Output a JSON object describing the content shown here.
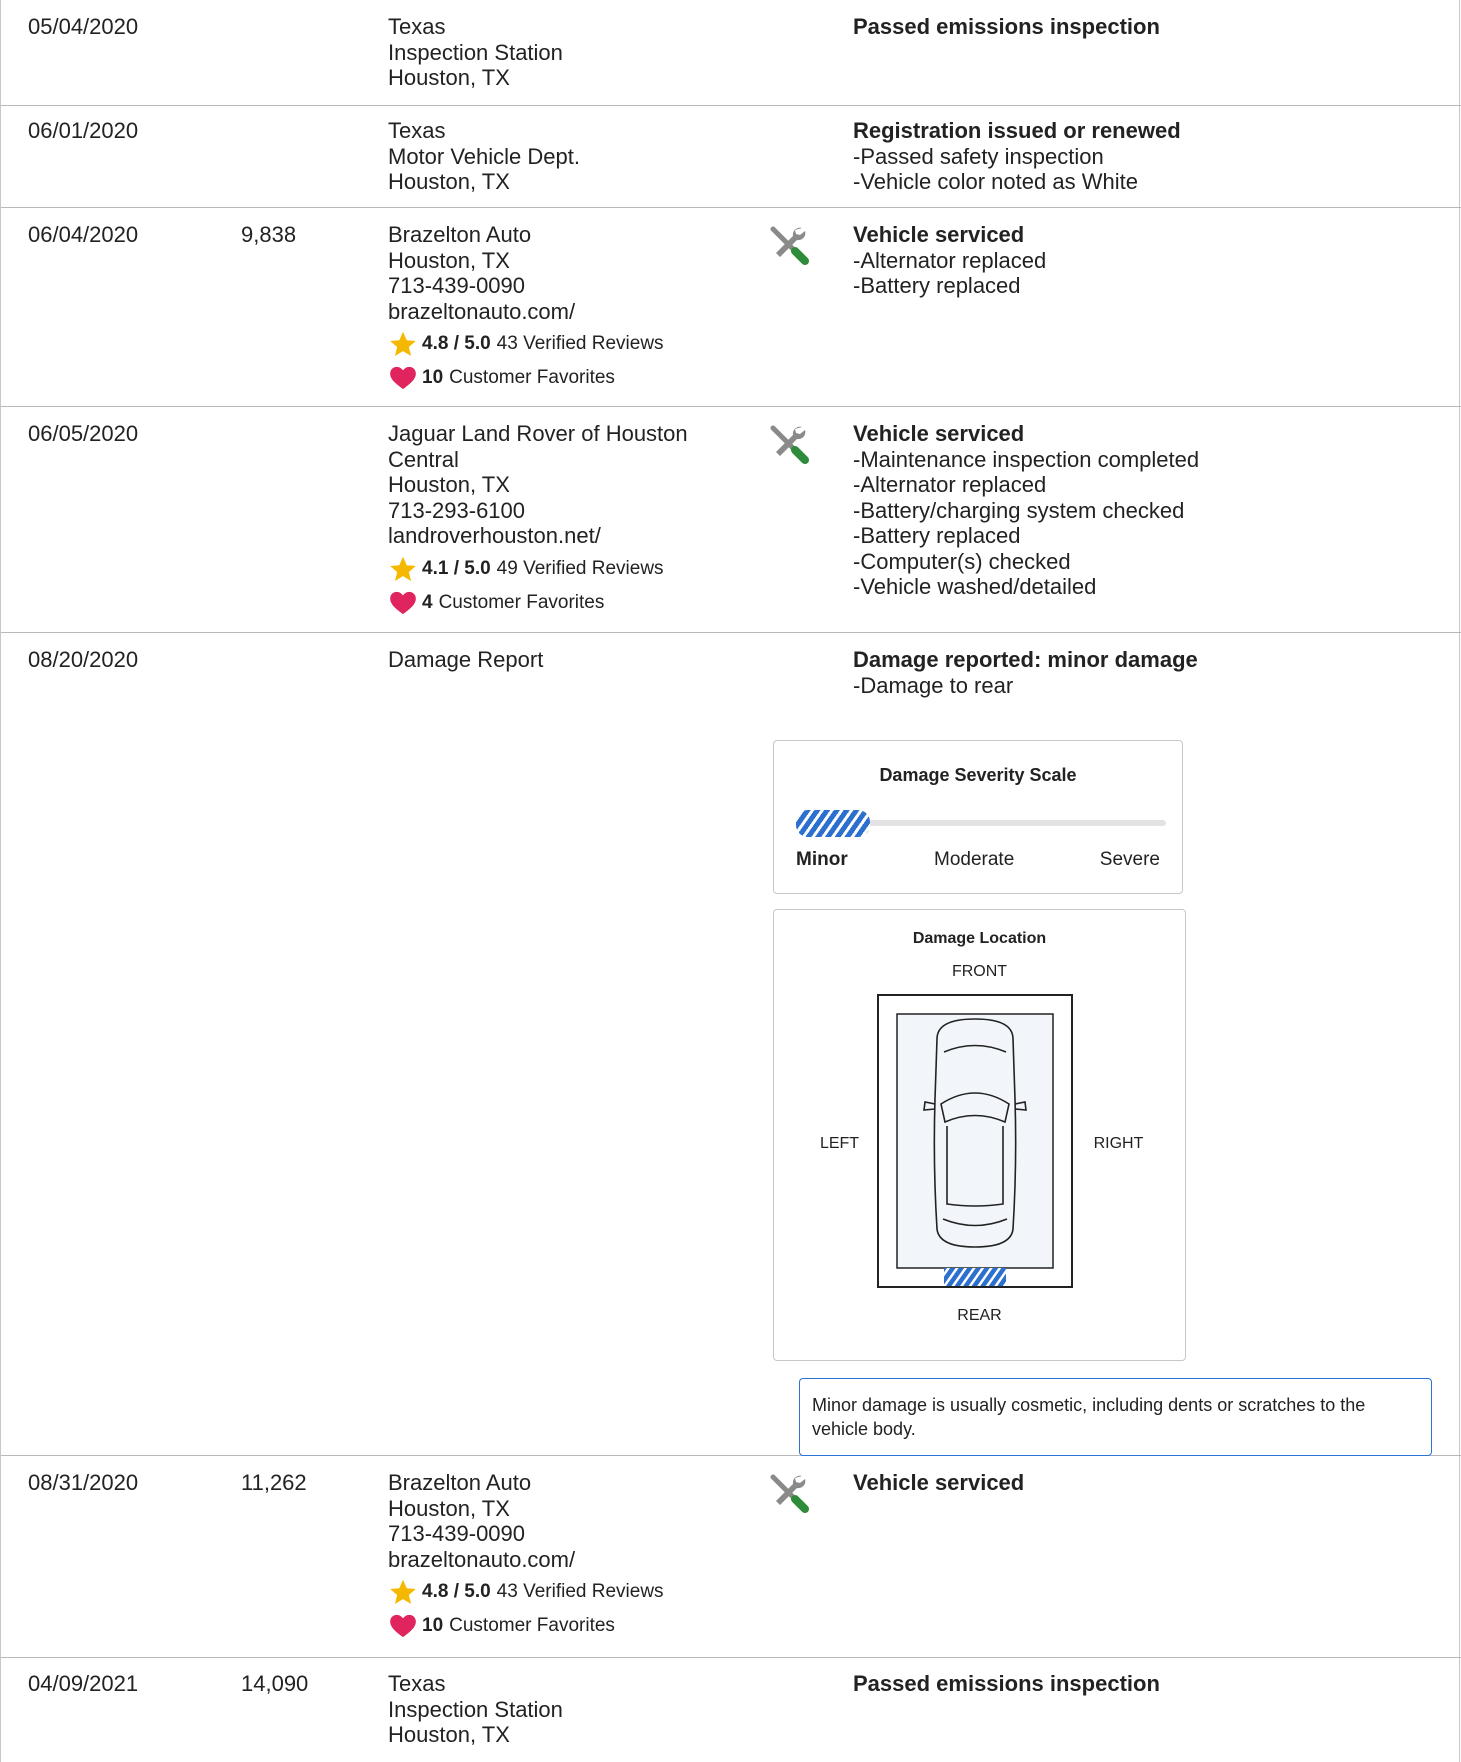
{
  "rows": [
    {
      "date": "05/04/2020",
      "odometer": "",
      "source": [
        "Texas",
        "Inspection Station",
        "Houston, TX"
      ],
      "title": "Passed emissions inspection",
      "items": []
    },
    {
      "date": "06/01/2020",
      "odometer": "",
      "source": [
        "Texas",
        "Motor Vehicle Dept.",
        "Houston, TX"
      ],
      "title": "Registration issued or renewed",
      "items": [
        "Passed safety inspection",
        "Vehicle color noted as White"
      ]
    },
    {
      "date": "06/04/2020",
      "odometer": "9,838",
      "source": [
        "Brazelton Auto",
        "Houston, TX",
        "713-439-0090",
        "brazeltonauto.com/"
      ],
      "rating": "4.8 / 5.0",
      "reviews": "43 Verified Reviews",
      "favorites_count": "10",
      "favorites_label": "Customer Favorites",
      "title": "Vehicle serviced",
      "items": [
        "Alternator replaced",
        "Battery replaced"
      ]
    },
    {
      "date": "06/05/2020",
      "odometer": "",
      "source": [
        "Jaguar Land Rover of Houston",
        "Central",
        "Houston, TX",
        "713-293-6100",
        "landroverhouston.net/"
      ],
      "rating": "4.1 / 5.0",
      "reviews": "49 Verified Reviews",
      "favorites_count": "4",
      "favorites_label": "Customer Favorites",
      "title": "Vehicle serviced",
      "items": [
        "Maintenance inspection completed",
        "Alternator replaced",
        "Battery/charging system checked",
        "Battery replaced",
        "Computer(s) checked",
        "Vehicle washed/detailed"
      ]
    },
    {
      "date": "08/20/2020",
      "odometer": "",
      "source": [
        "Damage Report"
      ],
      "title": "Damage reported: minor damage",
      "items": [
        "Damage to rear"
      ]
    },
    {
      "date": "08/31/2020",
      "odometer": "11,262",
      "source": [
        "Brazelton Auto",
        "Houston, TX",
        "713-439-0090",
        "brazeltonauto.com/"
      ],
      "rating": "4.8 / 5.0",
      "reviews": "43 Verified Reviews",
      "favorites_count": "10",
      "favorites_label": "Customer Favorites",
      "title": "Vehicle serviced",
      "items": []
    },
    {
      "date": "04/09/2021",
      "odometer": "14,090",
      "source": [
        "Texas",
        "Inspection Station",
        "Houston, TX"
      ],
      "title": "Passed emissions inspection",
      "items": []
    }
  ],
  "severity": {
    "title": "Damage Severity Scale",
    "levels": [
      "Minor",
      "Moderate",
      "Severe"
    ],
    "selected": "Minor",
    "fill_fraction": 0.2
  },
  "location": {
    "title": "Damage Location",
    "front": "FRONT",
    "rear": "REAR",
    "left": "LEFT",
    "right": "RIGHT",
    "damaged_side": "rear"
  },
  "note": "Minor damage is usually cosmetic, including dents or scratches to the vehicle body.",
  "colors": {
    "accent": "#2b6fcf",
    "star": "#f5b800",
    "heart": "#e0245e",
    "wrench": "#8a8a8a",
    "wrench_handle": "#2e8b3a"
  },
  "icons": {
    "service": "wrench-screwdriver-icon",
    "rating": "star-icon",
    "favorites": "heart-icon"
  }
}
